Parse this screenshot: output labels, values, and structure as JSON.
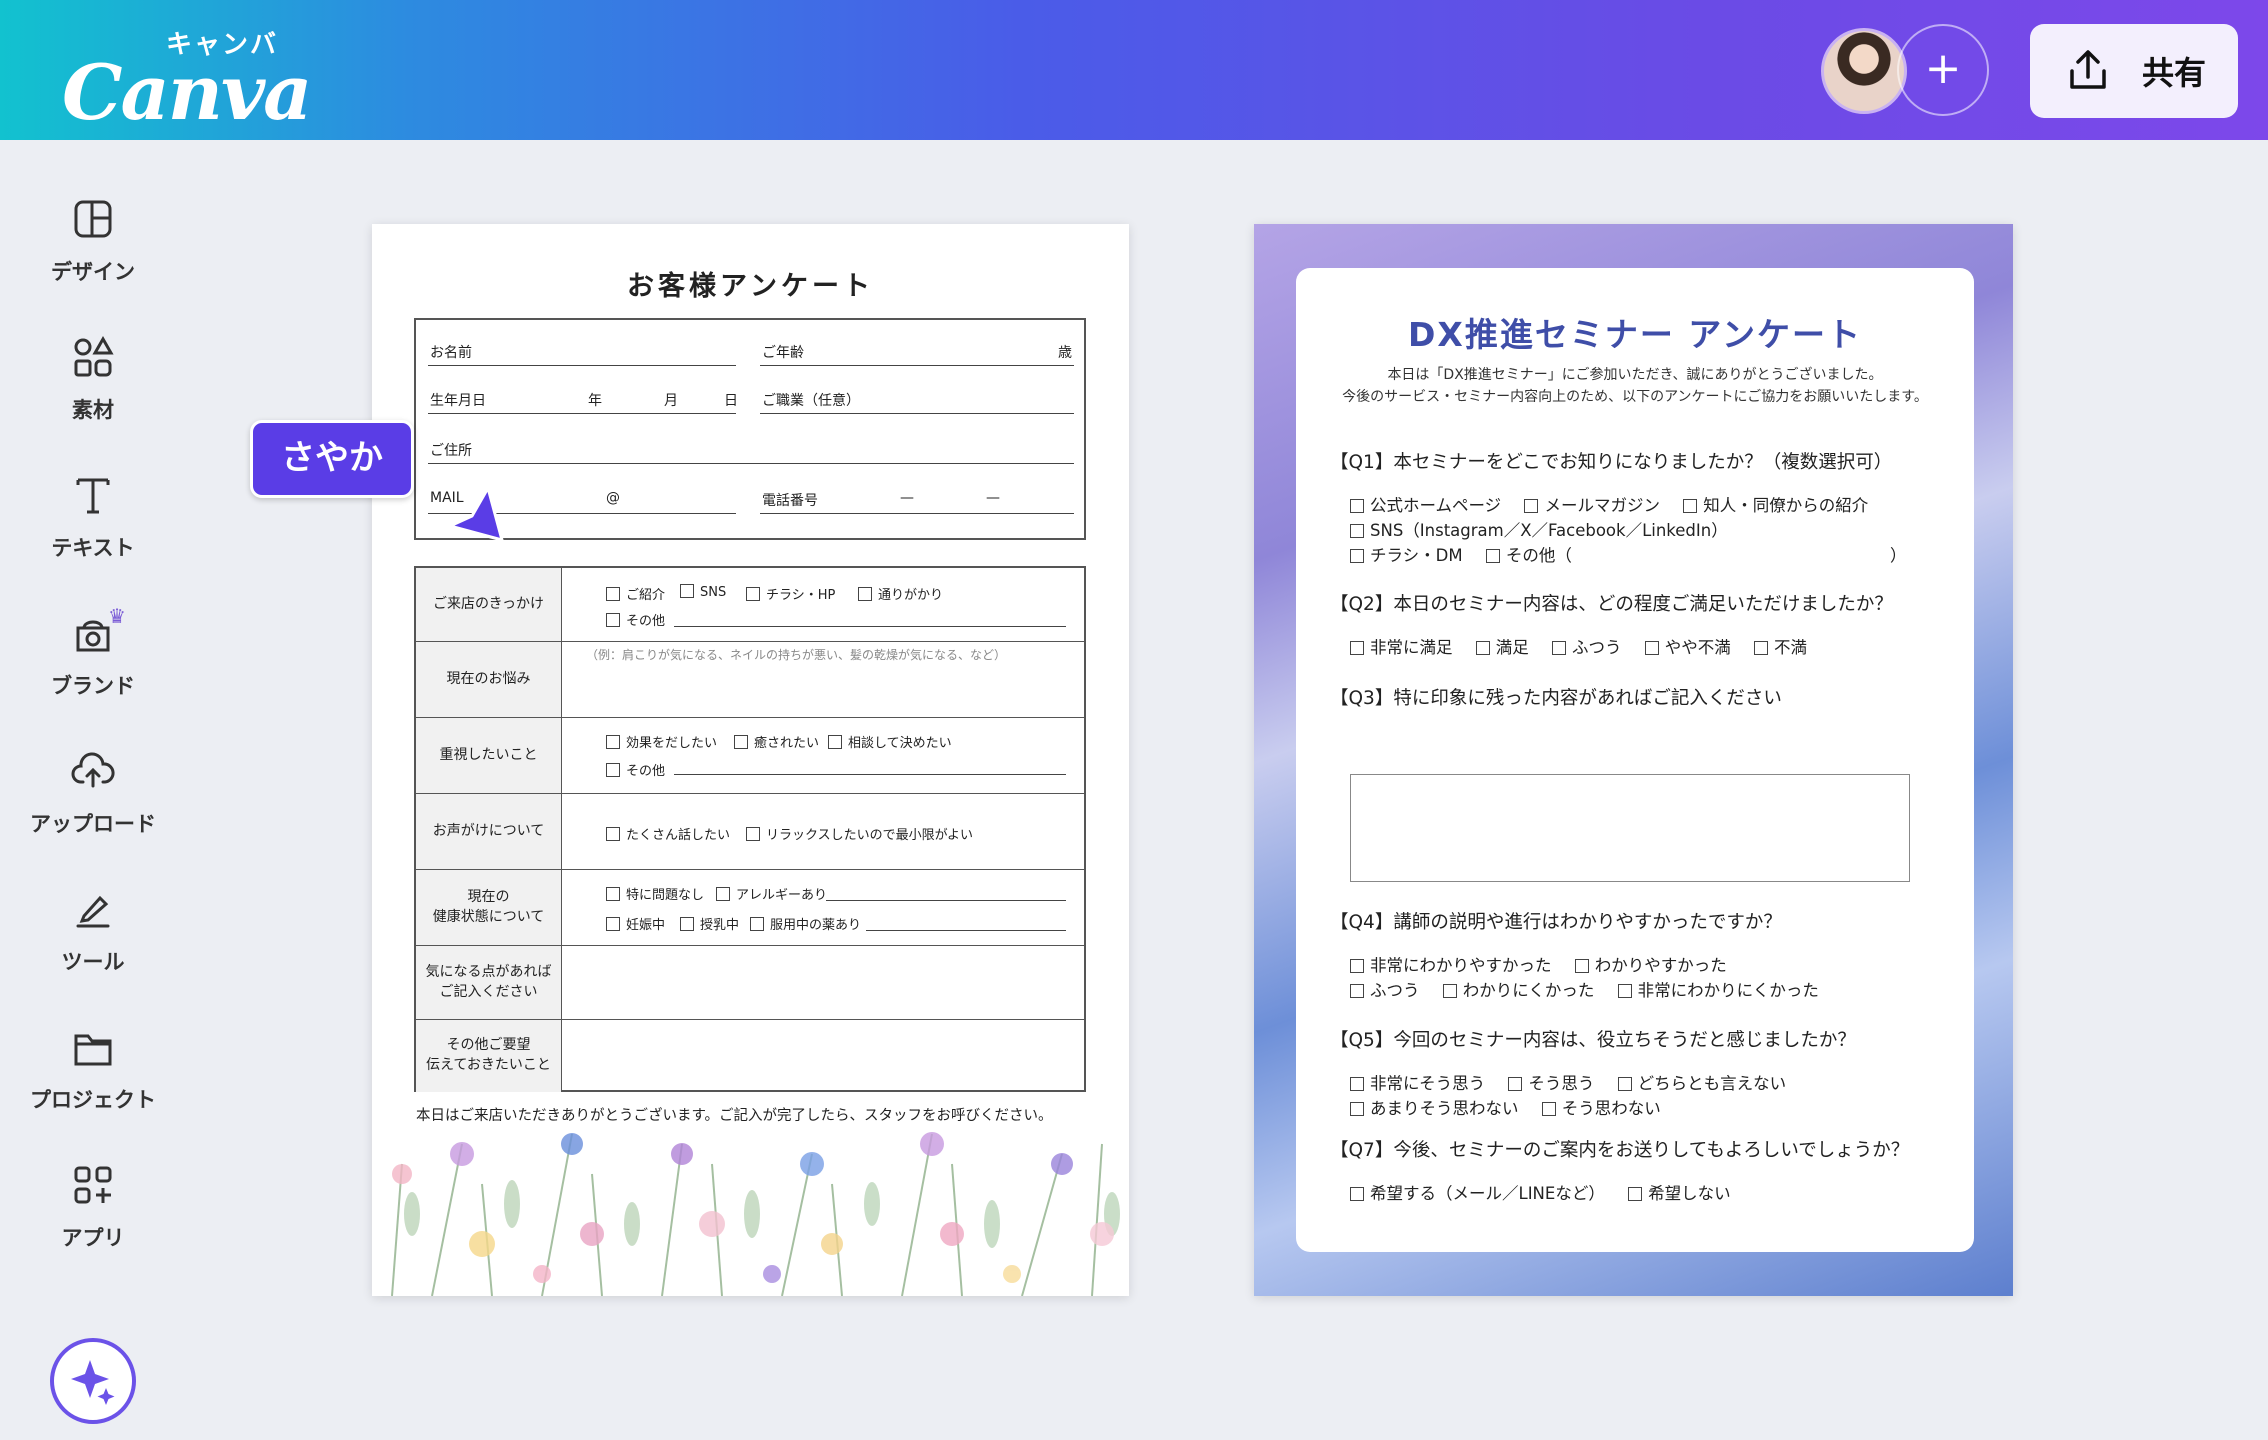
{
  "header": {
    "logo_kana": "キャンバ",
    "logo_word": "Canva",
    "add_collaborator": "+",
    "share_label": "共有"
  },
  "sidebar": {
    "items": [
      {
        "label": "デザイン",
        "icon": "design-icon"
      },
      {
        "label": "素材",
        "icon": "elements-icon"
      },
      {
        "label": "テキスト",
        "icon": "text-icon"
      },
      {
        "label": "ブランド",
        "icon": "brand-icon"
      },
      {
        "label": "アップロード",
        "icon": "upload-icon"
      },
      {
        "label": "ツール",
        "icon": "tools-icon"
      },
      {
        "label": "プロジェクト",
        "icon": "projects-icon"
      },
      {
        "label": "アプリ",
        "icon": "apps-icon"
      }
    ],
    "magic_icon": "sparkle-icon"
  },
  "collaborator": {
    "name": "さやか"
  },
  "page1": {
    "title": "お客様アンケート",
    "fields": {
      "name": "お名前",
      "age": "ご年齢",
      "age_unit": "歳",
      "birth": "生年月日",
      "year": "年",
      "month": "月",
      "day": "日",
      "job": "ご職業（任意）",
      "address": "ご住所",
      "mail": "MAIL",
      "at": "@",
      "phone": "電話番号",
      "dash": "—"
    },
    "rows": [
      {
        "head": "ご来店のきっかけ"
      },
      {
        "head": "現在のお悩み"
      },
      {
        "head": "重視したいこと"
      },
      {
        "head": "お声がけについて"
      },
      {
        "head": "現在の\n健康状態について"
      },
      {
        "head": "気になる点があれば\nご記入ください"
      },
      {
        "head": "その他ご要望\n伝えておきたいこと"
      }
    ],
    "opts": {
      "r1a": "ご紹介",
      "r1b": "SNS",
      "r1c": "チラシ・HP",
      "r1d": "通りがかり",
      "r1e": "その他",
      "r2hint": "（例：肩こりが気になる、ネイルの持ちが悪い、髪の乾燥が気になる、など）",
      "r3a": "効果をだしたい",
      "r3b": "癒されたい",
      "r3c": "相談して決めたい",
      "r3d": "その他",
      "r4a": "たくさん話したい",
      "r4b": "リラックスしたいので最小限がよい",
      "r5a": "特に問題なし",
      "r5b": "アレルギーあり",
      "r5c": "妊娠中",
      "r5d": "授乳中",
      "r5e": "服用中の薬あり"
    },
    "thanks": "本日はご来店いただきありがとうございます。ご記入が完了したら、スタッフをお呼びください。"
  },
  "page2": {
    "title": "DX推進セミナー アンケート",
    "intro1": "本日は「DX推進セミナー」にご参加いただき、誠にありがとうございました。",
    "intro2": "今後のサービス・セミナー内容向上のため、以下のアンケートにご協力をお願いいたします。",
    "q1": "【Q1】本セミナーをどこでお知りになりましたか？（複数選択可）",
    "q1a": "公式ホームページ",
    "q1b": "メールマガジン",
    "q1c": "知人・同僚からの紹介",
    "q1d": "SNS（Instagram／X／Facebook／LinkedIn）",
    "q1e": "チラシ・DM",
    "q1f": "その他（",
    "q1f_close": "）",
    "q2": "【Q2】本日のセミナー内容は、どの程度ご満足いただけましたか？",
    "q2a": "非常に満足",
    "q2b": "満足",
    "q2c": "ふつう",
    "q2d": "やや不満",
    "q2e": "不満",
    "q3": "【Q3】特に印象に残った内容があればご記入ください",
    "q4": "【Q4】講師の説明や進行はわかりやすかったですか？",
    "q4a": "非常にわかりやすかった",
    "q4b": "わかりやすかった",
    "q4c": "ふつう",
    "q4d": "わかりにくかった",
    "q4e": "非常にわかりにくかった",
    "q5": "【Q5】今回のセミナー内容は、役立ちそうだと感じましたか？",
    "q5a": "非常にそう思う",
    "q5b": "そう思う",
    "q5c": "どちらとも言えない",
    "q5d": "あまりそう思わない",
    "q5e": "そう思わない",
    "q7": "【Q7】今後、セミナーのご案内をお送りしてもよろしいでしょうか？",
    "q7a": "希望する（メール／LINEなど）",
    "q7b": "希望しない"
  }
}
